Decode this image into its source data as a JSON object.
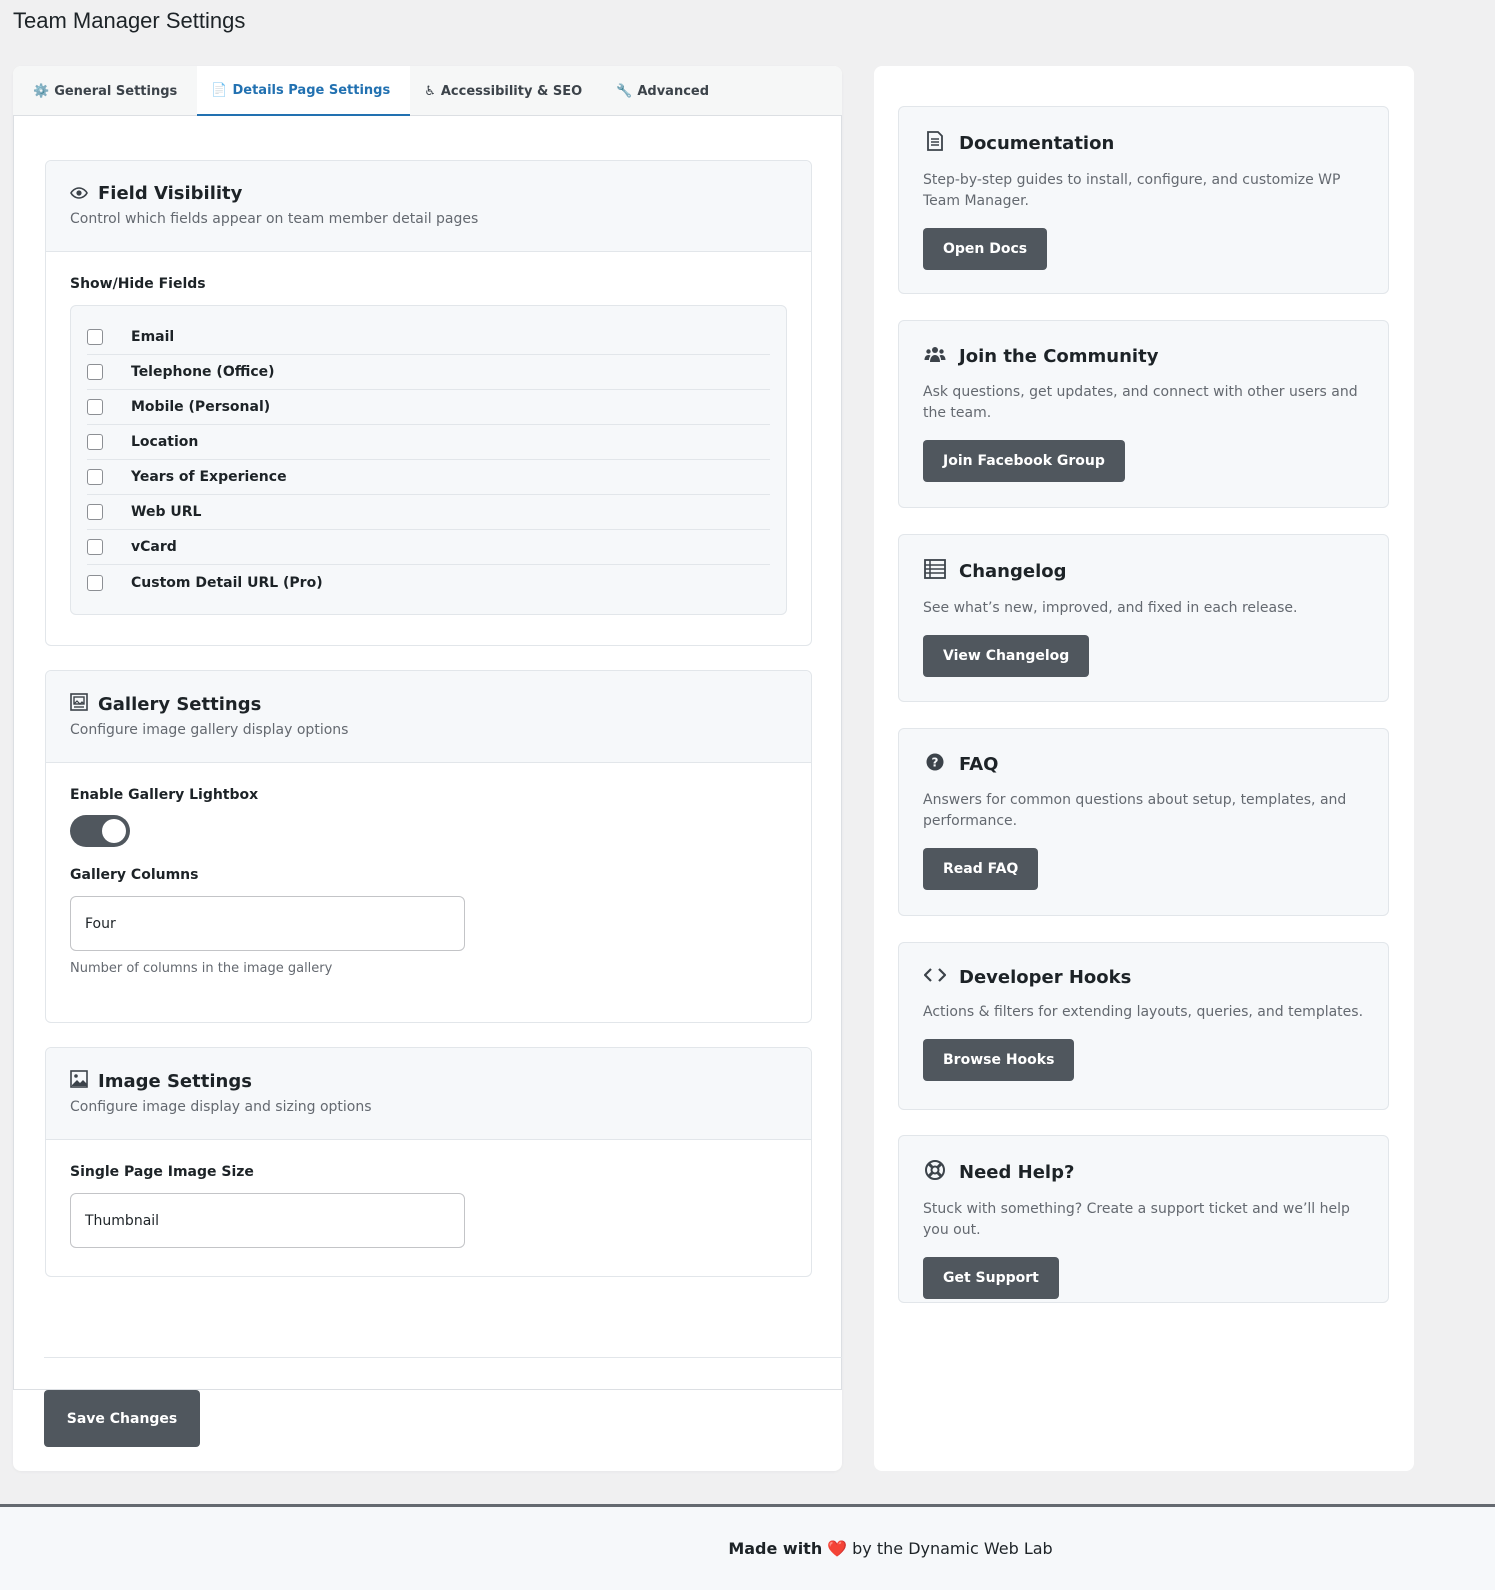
{
  "page_title": "Team Manager Settings",
  "tabs": [
    {
      "icon": "⚙️",
      "label": "General Settings"
    },
    {
      "icon": "📄",
      "label": "Details Page Settings"
    },
    {
      "icon": "♿",
      "label": "Accessibility & SEO"
    },
    {
      "icon": "🔧",
      "label": "Advanced"
    }
  ],
  "field_visibility": {
    "title": "Field Visibility",
    "subtitle": "Control which fields appear on team member detail pages",
    "group_label": "Show/Hide Fields",
    "fields": [
      "Email",
      "Telephone (Office)",
      "Mobile (Personal)",
      "Location",
      "Years of Experience",
      "Web URL",
      "vCard",
      "Custom Detail URL (Pro)"
    ]
  },
  "gallery": {
    "title": "Gallery Settings",
    "subtitle": "Configure image gallery display options",
    "lightbox_label": "Enable Gallery Lightbox",
    "lightbox_on": true,
    "columns_label": "Gallery Columns",
    "columns_value": "Four",
    "columns_help": "Number of columns in the image gallery"
  },
  "image": {
    "title": "Image Settings",
    "subtitle": "Configure image display and sizing options",
    "size_label": "Single Page Image Size",
    "size_value": "Thumbnail"
  },
  "save_label": "Save Changes",
  "cards": [
    {
      "icon": "document-icon",
      "title": "Documentation",
      "desc": "Step-by-step guides to install, configure, and customize WP Team Manager.",
      "button": "Open Docs"
    },
    {
      "icon": "community-icon",
      "title": "Join the Community",
      "desc": "Ask questions, get updates, and connect with other users and the team.",
      "button": "Join Facebook Group"
    },
    {
      "icon": "list-icon",
      "title": "Changelog",
      "desc": "See what’s new, improved, and fixed in each release.",
      "button": "View Changelog"
    },
    {
      "icon": "question-icon",
      "title": "FAQ",
      "desc": "Answers for common questions about setup, templates, and performance.",
      "button": "Read FAQ"
    },
    {
      "icon": "code-icon",
      "title": "Developer Hooks",
      "desc": "Actions & filters for extending layouts, queries, and templates.",
      "button": "Browse Hooks"
    },
    {
      "icon": "lifebuoy-icon",
      "title": "Need Help?",
      "desc": "Stuck with something? Create a support ticket and we’ll help you out.",
      "button": "Get Support"
    }
  ],
  "footer": {
    "prefix": "Made with",
    "heart": "❤️",
    "suffix": "by the Dynamic Web Lab"
  },
  "colors": {
    "accent": "#2271b1",
    "button": "#50575e"
  }
}
